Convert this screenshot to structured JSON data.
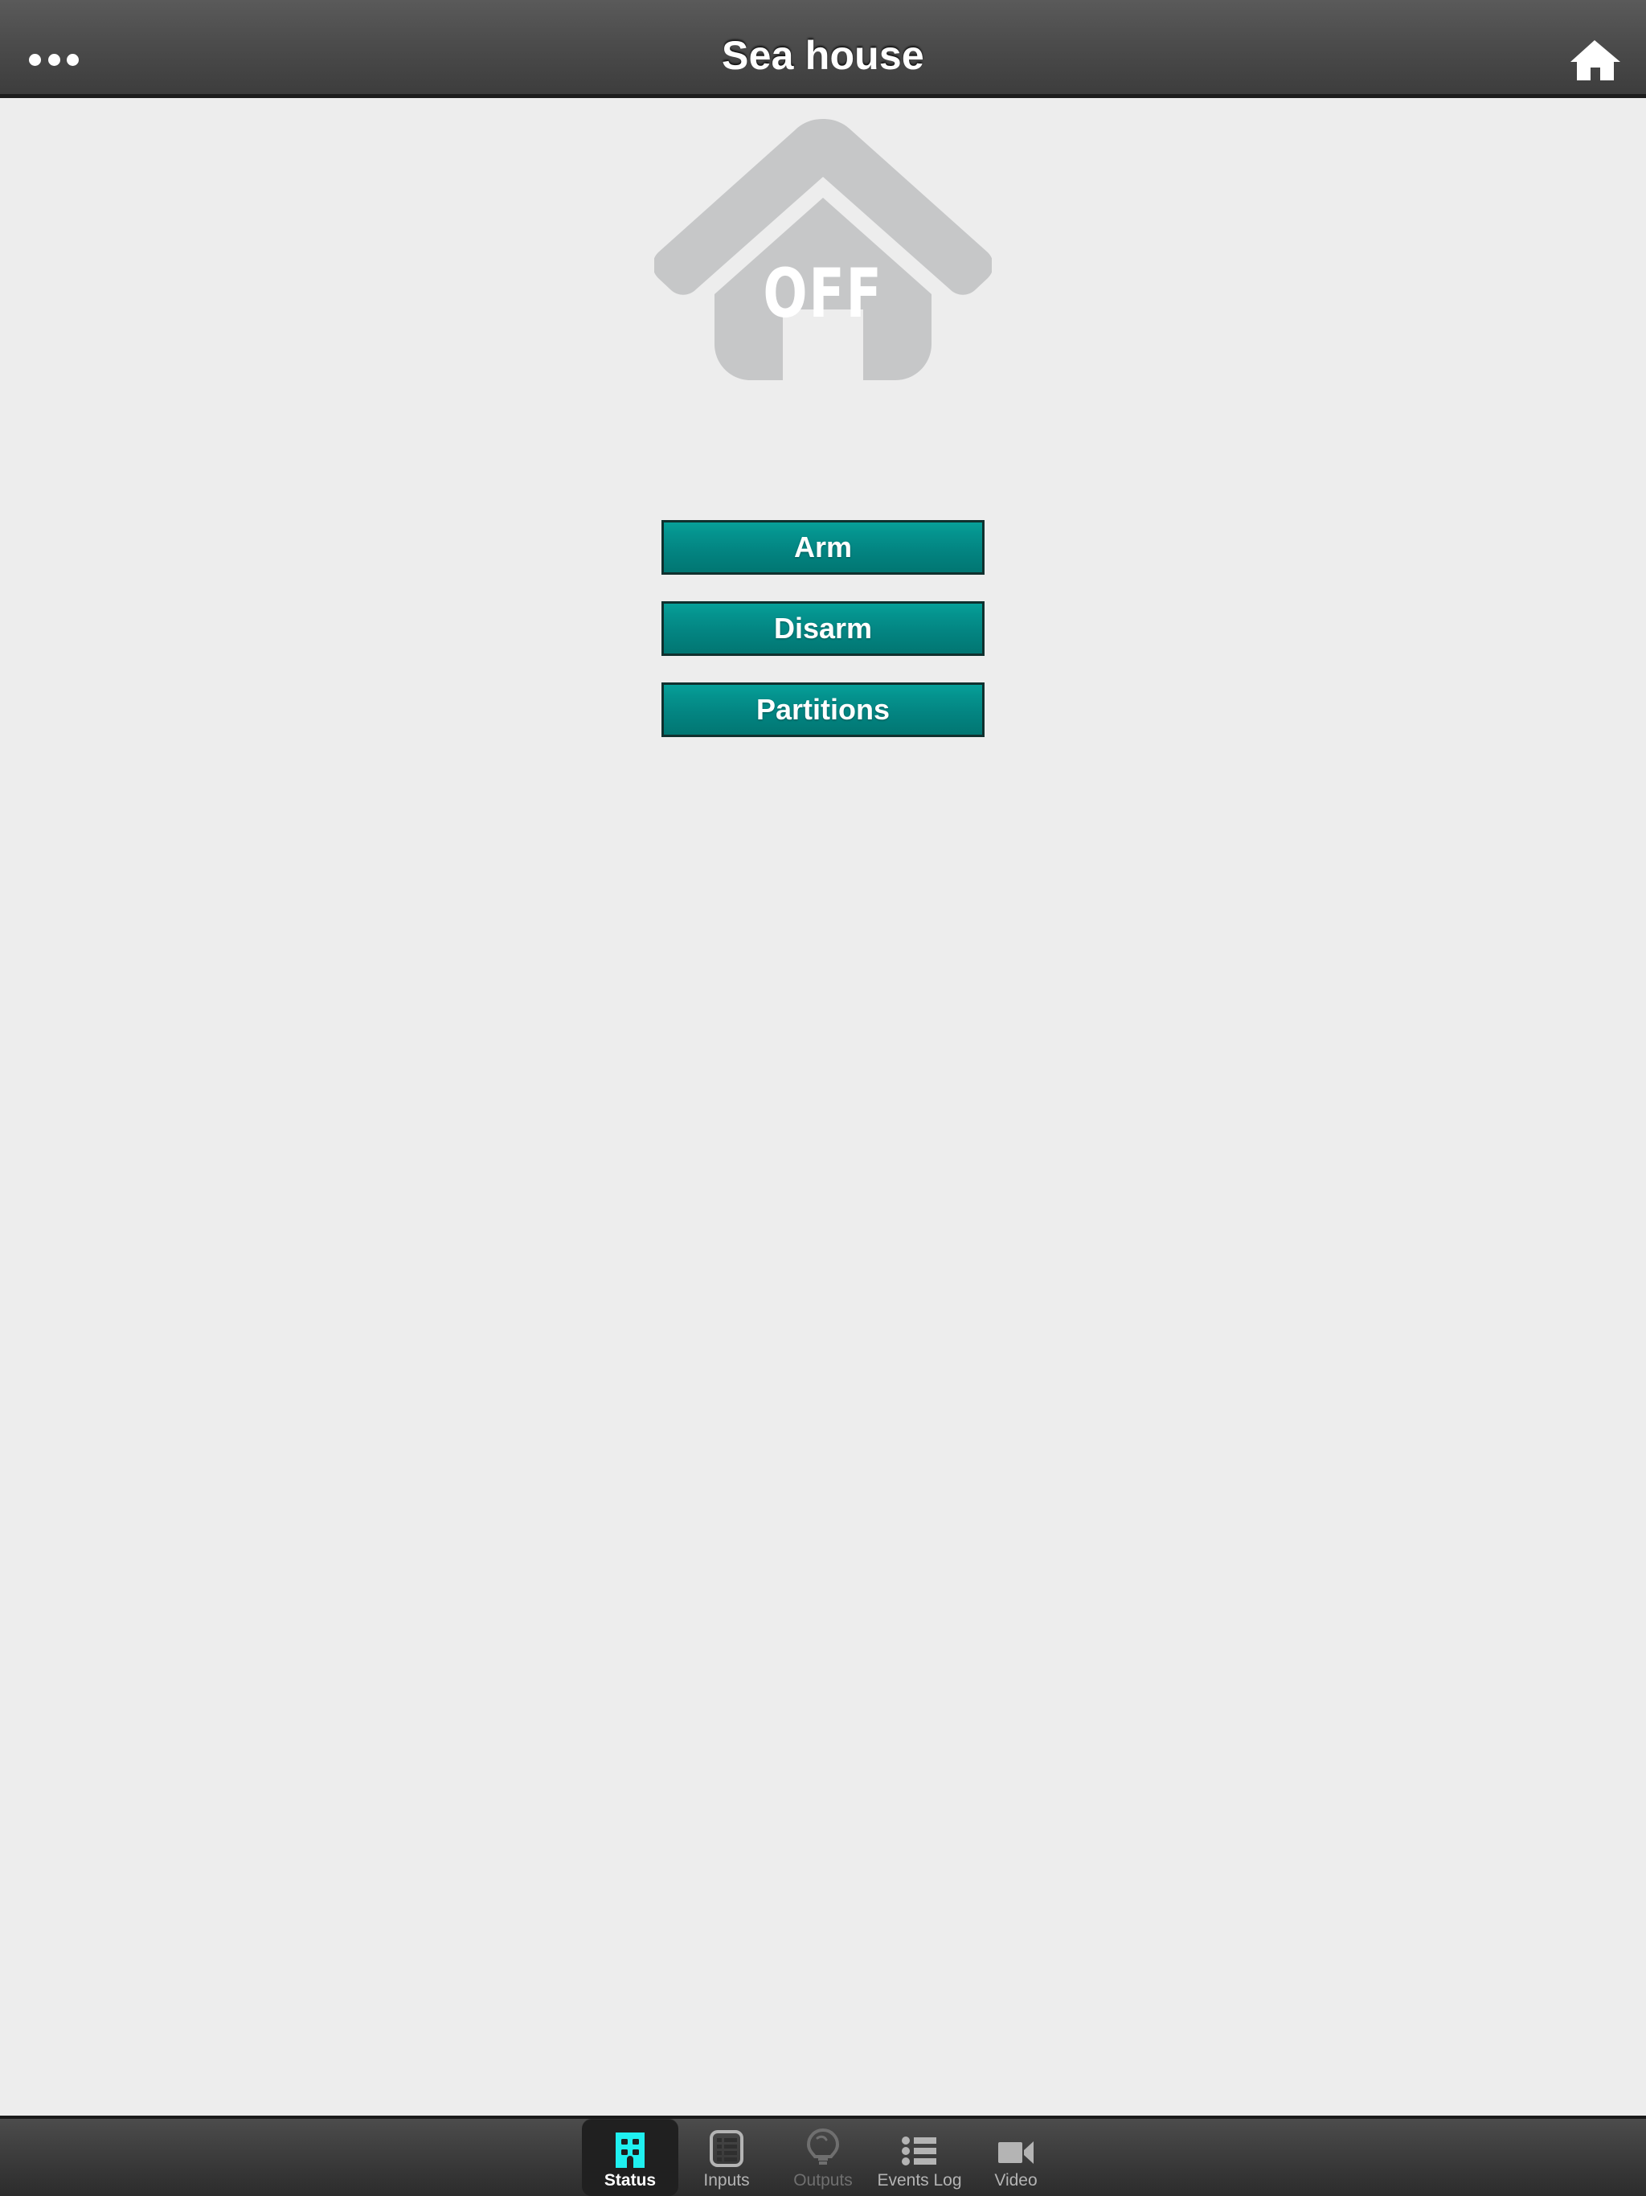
{
  "topbar": {
    "title": "Sea house",
    "menu_icon": "overflow-menu-icon",
    "home_icon": "home-icon"
  },
  "status": {
    "house_icon": "house-status-icon",
    "state_label": "OFF",
    "house_color": "#c6c7c8",
    "background_color": "#ededed"
  },
  "actions": {
    "accent_color": "#03918c",
    "buttons": [
      {
        "label": "Arm",
        "name": "arm-button"
      },
      {
        "label": "Disarm",
        "name": "disarm-button"
      },
      {
        "label": "Partitions",
        "name": "partitions-button"
      }
    ]
  },
  "tabbar": {
    "active_color": "#1ff0f0",
    "tabs": [
      {
        "label": "Status",
        "icon": "building-icon",
        "active": true,
        "disabled": false
      },
      {
        "label": "Inputs",
        "icon": "list-card-icon",
        "active": false,
        "disabled": false
      },
      {
        "label": "Outputs",
        "icon": "lightbulb-icon",
        "active": false,
        "disabled": true
      },
      {
        "label": "Events Log",
        "icon": "bullet-list-icon",
        "active": false,
        "disabled": false
      },
      {
        "label": "Video",
        "icon": "camcorder-icon",
        "active": false,
        "disabled": false
      }
    ]
  }
}
